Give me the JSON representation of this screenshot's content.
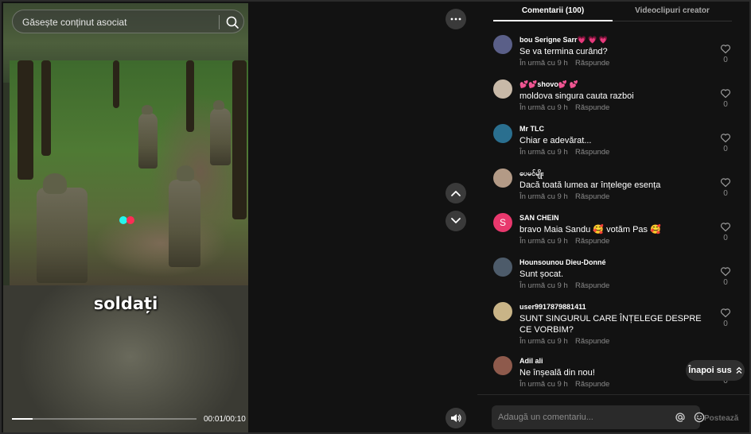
{
  "search": {
    "placeholder": "Găsește conținut asociat"
  },
  "video": {
    "caption": "soldați",
    "time": "00:01/00:10",
    "progress_fraction": 0.11
  },
  "tabs": [
    {
      "label": "Comentarii (100)",
      "active": true
    },
    {
      "label": "Videoclipuri creator",
      "active": false
    }
  ],
  "comments": [
    {
      "user": "bou Serigne Sarr💗 💗 💗",
      "text": "Se va termina curând?",
      "time": "În urmă cu 9 h",
      "reply": "Răspunde",
      "likes": "0",
      "avatar_color": "#5a5f88"
    },
    {
      "user": "💕💕shovo💕 💕",
      "text": "moldova singura cauta razboi",
      "time": "În urmă cu 9 h",
      "reply": "Răspunde",
      "likes": "0",
      "avatar_color": "#c8b9a8"
    },
    {
      "user": "Mr TLC",
      "text": "Chiar e adevărat...",
      "time": "În urmă cu 9 h",
      "reply": "Răspunde",
      "likes": "0",
      "avatar_color": "#2a6f8f"
    },
    {
      "user": "ပေမင်မျိုး",
      "text": "Dacă toată lumea ar înțelege esența",
      "time": "În urmă cu 9 h",
      "reply": "Răspunde",
      "likes": "0",
      "avatar_color": "#b39a86"
    },
    {
      "user": "SAN CHEIN",
      "text": "bravo Maia Sandu 🥰 votăm Pas 🥰",
      "time": "În urmă cu 9 h",
      "reply": "Răspunde",
      "likes": "0",
      "avatar_color": "#e8386d",
      "avatar_letter": "S"
    },
    {
      "user": "Hounsounou Dieu-Donné",
      "text": "Sunt șocat.",
      "time": "În urmă cu 9 h",
      "reply": "Răspunde",
      "likes": "0",
      "avatar_color": "#4d5b6a"
    },
    {
      "user": "user9917879881411",
      "text": "SUNT SINGURUL CARE ÎNȚELEGE DESPRE CE VORBIM?",
      "time": "În urmă cu 9 h",
      "reply": "Răspunde",
      "likes": "0",
      "avatar_color": "#c9b487"
    },
    {
      "user": "Adil ali",
      "text": "Ne înșeală din nou!",
      "time": "În urmă cu 9 h",
      "reply": "Răspunde",
      "likes": "0",
      "avatar_color": "#8e5a4c"
    }
  ],
  "back_to_top": {
    "label": "Înapoi sus"
  },
  "composer": {
    "placeholder": "Adaugă un comentariu...",
    "post_label": "Postează"
  },
  "colors": {
    "accent_pink": "#fe2c55",
    "accent_cyan": "#25f4ee",
    "panel_bg": "#121212"
  }
}
